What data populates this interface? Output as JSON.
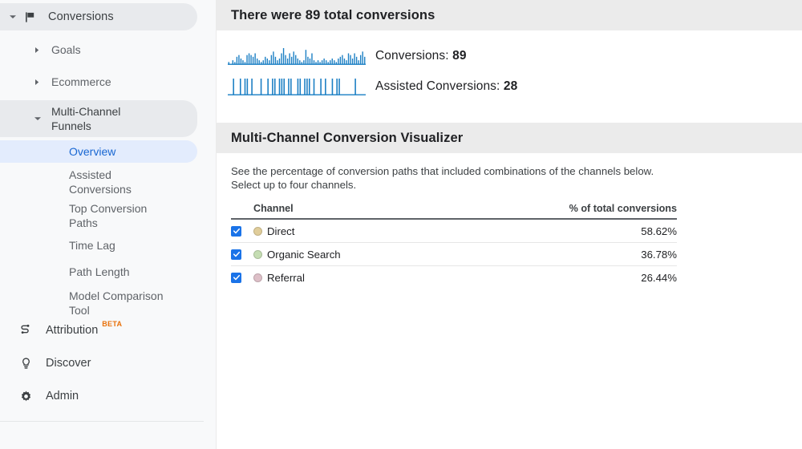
{
  "sidebar": {
    "top_nav": {
      "label": "Conversions",
      "icon": "flag-icon",
      "expanded": true
    },
    "groups": [
      {
        "label": "Goals",
        "expanded": false
      },
      {
        "label": "Ecommerce",
        "expanded": false
      },
      {
        "label": "Multi-Channel Funnels",
        "expanded": true
      }
    ],
    "sub_items": [
      {
        "label": "Overview",
        "active": true
      },
      {
        "label": "Assisted Conversions",
        "active": false
      },
      {
        "label": "Top Conversion Paths",
        "active": false
      },
      {
        "label": "Time Lag",
        "active": false
      },
      {
        "label": "Path Length",
        "active": false
      },
      {
        "label": "Model Comparison Tool",
        "active": false
      }
    ],
    "bottom_items": [
      {
        "label": "Attribution",
        "icon": "attribution-icon",
        "badge": "BETA"
      },
      {
        "label": "Discover",
        "icon": "lightbulb-icon",
        "badge": ""
      },
      {
        "label": "Admin",
        "icon": "gear-icon",
        "badge": ""
      }
    ]
  },
  "conversions_panel": {
    "title": "There were 89 total conversions",
    "metrics": [
      {
        "label": "Conversions:",
        "value": "89"
      },
      {
        "label": "Assisted Conversions:",
        "value": "28"
      }
    ]
  },
  "visualizer": {
    "title": "Multi-Channel Conversion Visualizer",
    "description_line1": "See the percentage of conversion paths that included combinations of the channels below.",
    "description_line2": "Select up to four channels.",
    "table": {
      "headers": {
        "channel": "Channel",
        "percent": "% of total conversions"
      },
      "rows": [
        {
          "checked": true,
          "channel": "Direct",
          "percent": "58.62%",
          "color": "#e0cd9a"
        },
        {
          "checked": true,
          "channel": "Organic Search",
          "percent": "36.78%",
          "color": "#c5ddb3"
        },
        {
          "checked": true,
          "channel": "Referral",
          "percent": "26.44%",
          "color": "#ddbfc7"
        }
      ]
    }
  },
  "chart_data": [
    {
      "type": "bar",
      "title": "Conversions sparkline",
      "ylabel": "Conversions",
      "total": 89,
      "values": [
        1,
        0,
        2,
        1,
        4,
        5,
        3,
        2,
        1,
        5,
        6,
        5,
        4,
        6,
        3,
        2,
        1,
        2,
        4,
        3,
        2,
        5,
        7,
        4,
        2,
        3,
        6,
        9,
        5,
        3,
        6,
        4,
        7,
        5,
        3,
        2,
        1,
        2,
        8,
        4,
        3,
        6,
        2,
        1,
        2,
        1,
        2,
        3,
        2,
        1,
        2,
        3,
        2,
        1,
        3,
        4,
        5,
        3,
        2,
        6,
        5,
        3,
        6,
        4,
        2,
        5,
        7,
        4
      ]
    },
    {
      "type": "bar",
      "title": "Assisted Conversions sparkline",
      "ylabel": "Assisted Conversions",
      "total": 28,
      "values": [
        0,
        0,
        9,
        0,
        0,
        9,
        0,
        9,
        9,
        0,
        9,
        0,
        0,
        0,
        9,
        0,
        0,
        9,
        0,
        9,
        9,
        0,
        9,
        9,
        9,
        0,
        9,
        9,
        0,
        0,
        9,
        9,
        0,
        9,
        9,
        9,
        0,
        9,
        0,
        0,
        9,
        0,
        9,
        0,
        0,
        9,
        0,
        9,
        9,
        0,
        0,
        0,
        0,
        0,
        0,
        9,
        0,
        0,
        0,
        0
      ]
    }
  ],
  "colors": {
    "accent_blue": "#1a73e8",
    "spark_blue": "#1b7fc4",
    "beta_orange": "#e8710a",
    "header_gray": "#ebebeb"
  }
}
